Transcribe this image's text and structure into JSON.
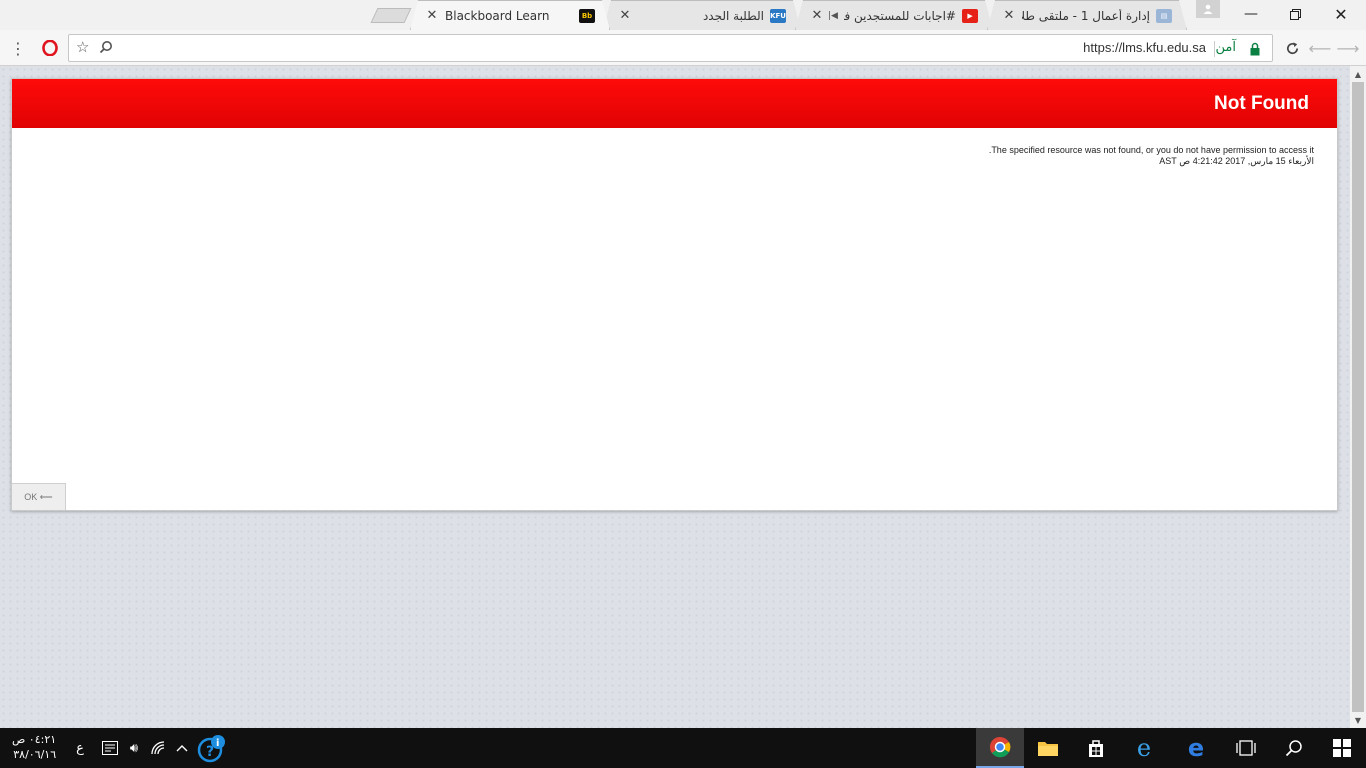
{
  "browser": {
    "tabs": [
      {
        "title": "Blackboard Learn",
        "favicon": "Bb",
        "active": true
      },
      {
        "title": "الطلبة الجدد",
        "favicon": "KFU",
        "active": false
      },
      {
        "title": "#اجابات للمستجدين في",
        "favicon": "youtube-icon",
        "active": false
      },
      {
        "title": "إدارة أعمال 1 - ملتقى طلا",
        "favicon": "doc-icon",
        "active": false
      }
    ],
    "address": {
      "url": "https://lms.kfu.edu.sa",
      "security_label": "آمن"
    }
  },
  "page": {
    "header_title": "Not Found",
    "message": ".The specified resource was not found, or you do not have permission to access it",
    "timestamp": "الأربعاء 15 مارس, 2017 4:21:42 ص AST",
    "ok_label": "OK ⟵"
  },
  "colors": {
    "header_red": "#f40808",
    "page_bg": "#dde1e7",
    "taskbar": "#101010"
  },
  "taskbar": {
    "clock_time": "٠٤:٢١ ص",
    "clock_date": "٣٨/٠٦/١٦",
    "lang": "ع",
    "apps": [
      "chrome-icon",
      "file-explorer-icon",
      "store-icon",
      "ie-icon",
      "edge-icon",
      "task-view-icon",
      "search-icon",
      "start-icon"
    ]
  }
}
